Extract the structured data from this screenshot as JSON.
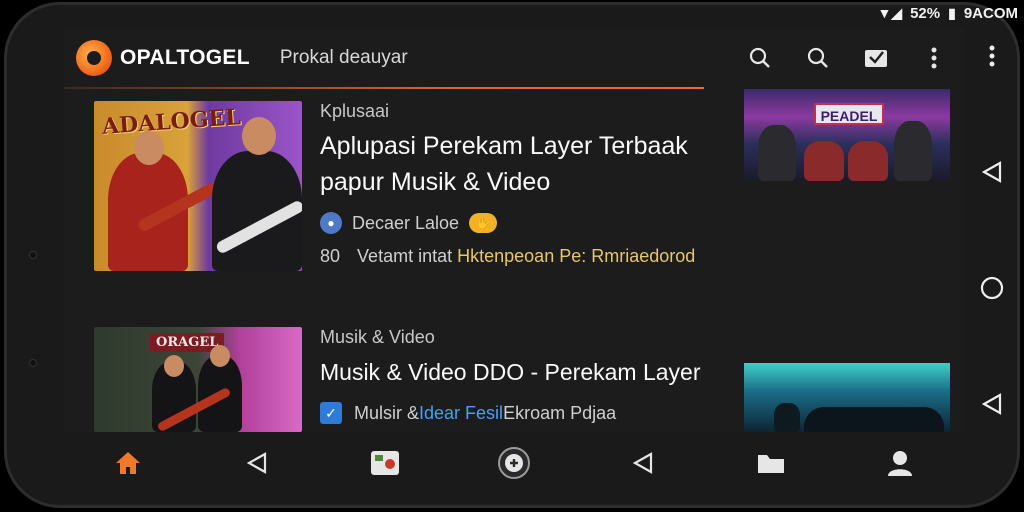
{
  "status_bar": {
    "signal_icon": "wifi-signal-icon",
    "battery_text": "5",
    "battery_percent": "52%",
    "carrier": "9ACOM"
  },
  "app_bar": {
    "logo_icon": "opaltogel-logo-icon",
    "app_name": "OPALTOGEL",
    "subtitle": "Prokal deauyar",
    "actions": [
      {
        "icon": "search-icon"
      },
      {
        "icon": "search-icon"
      },
      {
        "icon": "cast-icon"
      },
      {
        "icon": "more-vertical-icon"
      }
    ],
    "accent": "#f06a2a"
  },
  "cards": [
    {
      "thumb_label": "ADALOGEL",
      "category": "Kplusaai",
      "side_label": "ꜛ",
      "title": "Aplupasi Perekam Layer Terbaak papur Musik & Video",
      "channel": "Decaer Laloe",
      "channel_badge": "🤲",
      "views": "80",
      "stats_prefix": "Vetamt intat",
      "stats_highlight": "Hktenpeoan Pe: Rmriaedorod",
      "side_thumb_sign": "PEADEL"
    },
    {
      "thumb_label": "ORAGEL",
      "category": "Musik & Video",
      "side_label": "ꜛ ꜛꜛꜛ",
      "title": "Musik & Video DDO - Perekam Layer",
      "check_icon": "checkbox-checked-icon",
      "meta_prefix": "Mulsir & ",
      "meta_highlight": "Idear Fesil",
      "meta_suffix": " Ekroam Pdjaa"
    }
  ],
  "side_more_label": "ꜛ ꜛꜛꜛ",
  "bottom_nav": [
    {
      "icon": "home-icon",
      "active": true
    },
    {
      "icon": "back-triangle-icon"
    },
    {
      "icon": "gallery-icon"
    },
    {
      "icon": "compass-icon"
    },
    {
      "icon": "back-triangle-icon"
    },
    {
      "icon": "folder-icon"
    },
    {
      "icon": "profile-icon"
    }
  ],
  "system_nav": [
    {
      "icon": "more-vertical-icon"
    },
    {
      "icon": "back-triangle-icon"
    },
    {
      "icon": "home-circle-icon"
    },
    {
      "icon": "back-triangle-icon"
    }
  ]
}
